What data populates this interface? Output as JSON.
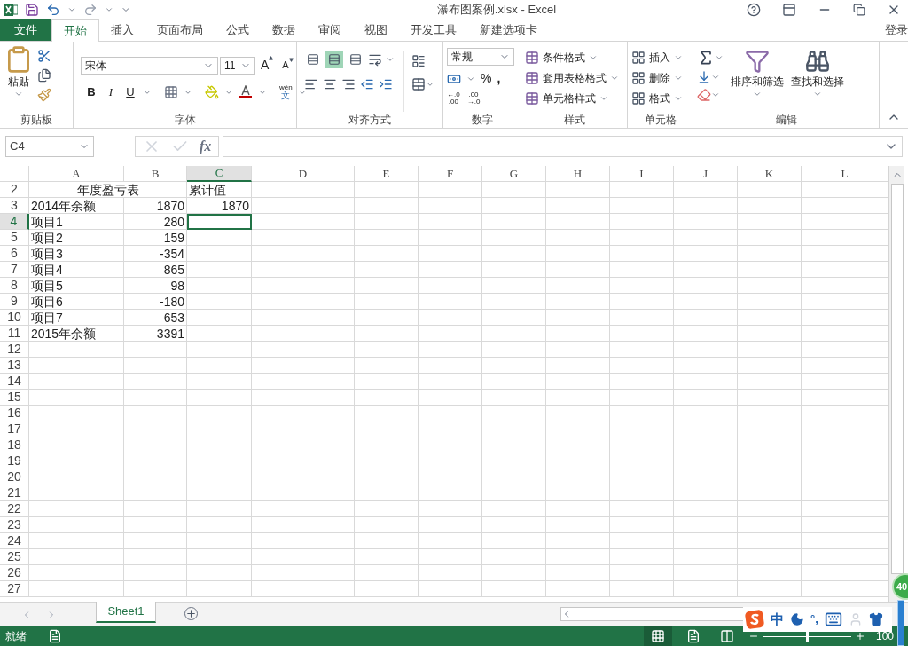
{
  "window": {
    "title": "瀑布图案例.xlsx - Excel",
    "account": "登录"
  },
  "file_tab": "文件",
  "ribbon_tabs": [
    {
      "label": "开始",
      "selected": true
    },
    {
      "label": "插入",
      "selected": false
    },
    {
      "label": "页面布局",
      "selected": false
    },
    {
      "label": "公式",
      "selected": false
    },
    {
      "label": "数据",
      "selected": false
    },
    {
      "label": "审阅",
      "selected": false
    },
    {
      "label": "视图",
      "selected": false
    },
    {
      "label": "开发工具",
      "selected": false
    },
    {
      "label": "新建选项卡",
      "selected": false
    }
  ],
  "clipboard": {
    "paste": "粘贴",
    "label": "剪贴板"
  },
  "font": {
    "name": "宋体",
    "size": "11",
    "bold": "B",
    "italic": "I",
    "underline": "U",
    "grow": "A",
    "shrink": "A",
    "phonetic_top": "wén",
    "phonetic_bottom": "文",
    "label": "字体"
  },
  "alignment": {
    "vertical": [
      {
        "selected": false
      },
      {
        "selected": true
      },
      {
        "selected": false
      }
    ],
    "label": "对齐方式"
  },
  "number": {
    "format": "常规",
    "percent": "%",
    "comma": ",",
    "inc_top": "←.0",
    "inc_bottom": ".00",
    "dec_top": ".00",
    "dec_bottom": "→.0",
    "label": "数字"
  },
  "styles": {
    "items": [
      "条件格式",
      "套用表格格式",
      "单元格样式"
    ],
    "label": "样式"
  },
  "cells": {
    "items": [
      "插入",
      "删除",
      "格式"
    ],
    "label": "单元格"
  },
  "editing": {
    "sort": "排序和筛选",
    "find": "查找和选择",
    "label": "编辑"
  },
  "formula_bar": {
    "name_box": "C4",
    "fx": "fx"
  },
  "sheet": {
    "columns": [
      {
        "label": "A",
        "selected": false
      },
      {
        "label": "B",
        "selected": false
      },
      {
        "label": "C",
        "selected": true
      },
      {
        "label": "D",
        "selected": false
      },
      {
        "label": "E",
        "selected": false
      },
      {
        "label": "F",
        "selected": false
      },
      {
        "label": "G",
        "selected": false
      },
      {
        "label": "H",
        "selected": false
      },
      {
        "label": "I",
        "selected": false
      },
      {
        "label": "J",
        "selected": false
      },
      {
        "label": "K",
        "selected": false
      },
      {
        "label": "L",
        "selected": false
      }
    ],
    "rows": [
      {
        "header": "2",
        "selected": false,
        "cells": [
          {
            "text": "年度盈亏表",
            "kind": "merged",
            "active": false
          },
          {
            "text": "累计值",
            "kind": "text",
            "active": false
          }
        ]
      },
      {
        "header": "3",
        "selected": false,
        "cells": [
          {
            "text": "2014年余额",
            "kind": "text",
            "active": false
          },
          {
            "text": "1870",
            "kind": "number",
            "active": false
          },
          {
            "text": "1870",
            "kind": "number",
            "active": false
          }
        ]
      },
      {
        "header": "4",
        "selected": true,
        "cells": [
          {
            "text": "项目1",
            "kind": "text",
            "active": false
          },
          {
            "text": "280",
            "kind": "number",
            "active": false
          },
          {
            "kind": "empty",
            "active": true
          }
        ]
      },
      {
        "header": "5",
        "selected": false,
        "cells": [
          {
            "text": "项目2",
            "kind": "text",
            "active": false
          },
          {
            "text": "159",
            "kind": "number",
            "active": false
          }
        ]
      },
      {
        "header": "6",
        "selected": false,
        "cells": [
          {
            "text": "项目3",
            "kind": "text",
            "active": false
          },
          {
            "text": "-354",
            "kind": "number",
            "active": false
          }
        ]
      },
      {
        "header": "7",
        "selected": false,
        "cells": [
          {
            "text": "项目4",
            "kind": "text",
            "active": false
          },
          {
            "text": "865",
            "kind": "number",
            "active": false
          }
        ]
      },
      {
        "header": "8",
        "selected": false,
        "cells": [
          {
            "text": "项目5",
            "kind": "text",
            "active": false
          },
          {
            "text": "98",
            "kind": "number",
            "active": false
          }
        ]
      },
      {
        "header": "9",
        "selected": false,
        "cells": [
          {
            "text": "项目6",
            "kind": "text",
            "active": false
          },
          {
            "text": "-180",
            "kind": "number",
            "active": false
          }
        ]
      },
      {
        "header": "10",
        "selected": false,
        "cells": [
          {
            "text": "项目7",
            "kind": "text",
            "active": false
          },
          {
            "text": "653",
            "kind": "number",
            "active": false
          }
        ]
      },
      {
        "header": "11",
        "selected": false,
        "cells": [
          {
            "text": "2015年余额",
            "kind": "text",
            "active": false
          },
          {
            "text": "3391",
            "kind": "number",
            "active": false
          }
        ]
      },
      {
        "header": "12"
      },
      {
        "header": "13"
      },
      {
        "header": "14"
      },
      {
        "header": "15"
      },
      {
        "header": "16"
      },
      {
        "header": "17"
      },
      {
        "header": "18"
      },
      {
        "header": "19"
      },
      {
        "header": "20"
      },
      {
        "header": "21"
      },
      {
        "header": "22"
      },
      {
        "header": "23"
      },
      {
        "header": "24"
      },
      {
        "header": "25"
      },
      {
        "header": "26"
      },
      {
        "header": "27"
      }
    ]
  },
  "sheet_tabs": [
    {
      "label": "Sheet1",
      "selected": true
    }
  ],
  "status_bar": {
    "status": "就绪",
    "zoom": "100",
    "zoom_slider": {
      "level": 0.5
    }
  },
  "ime_bar": {
    "mode": "中",
    "punct": "°,"
  },
  "floating_badge": "40"
}
